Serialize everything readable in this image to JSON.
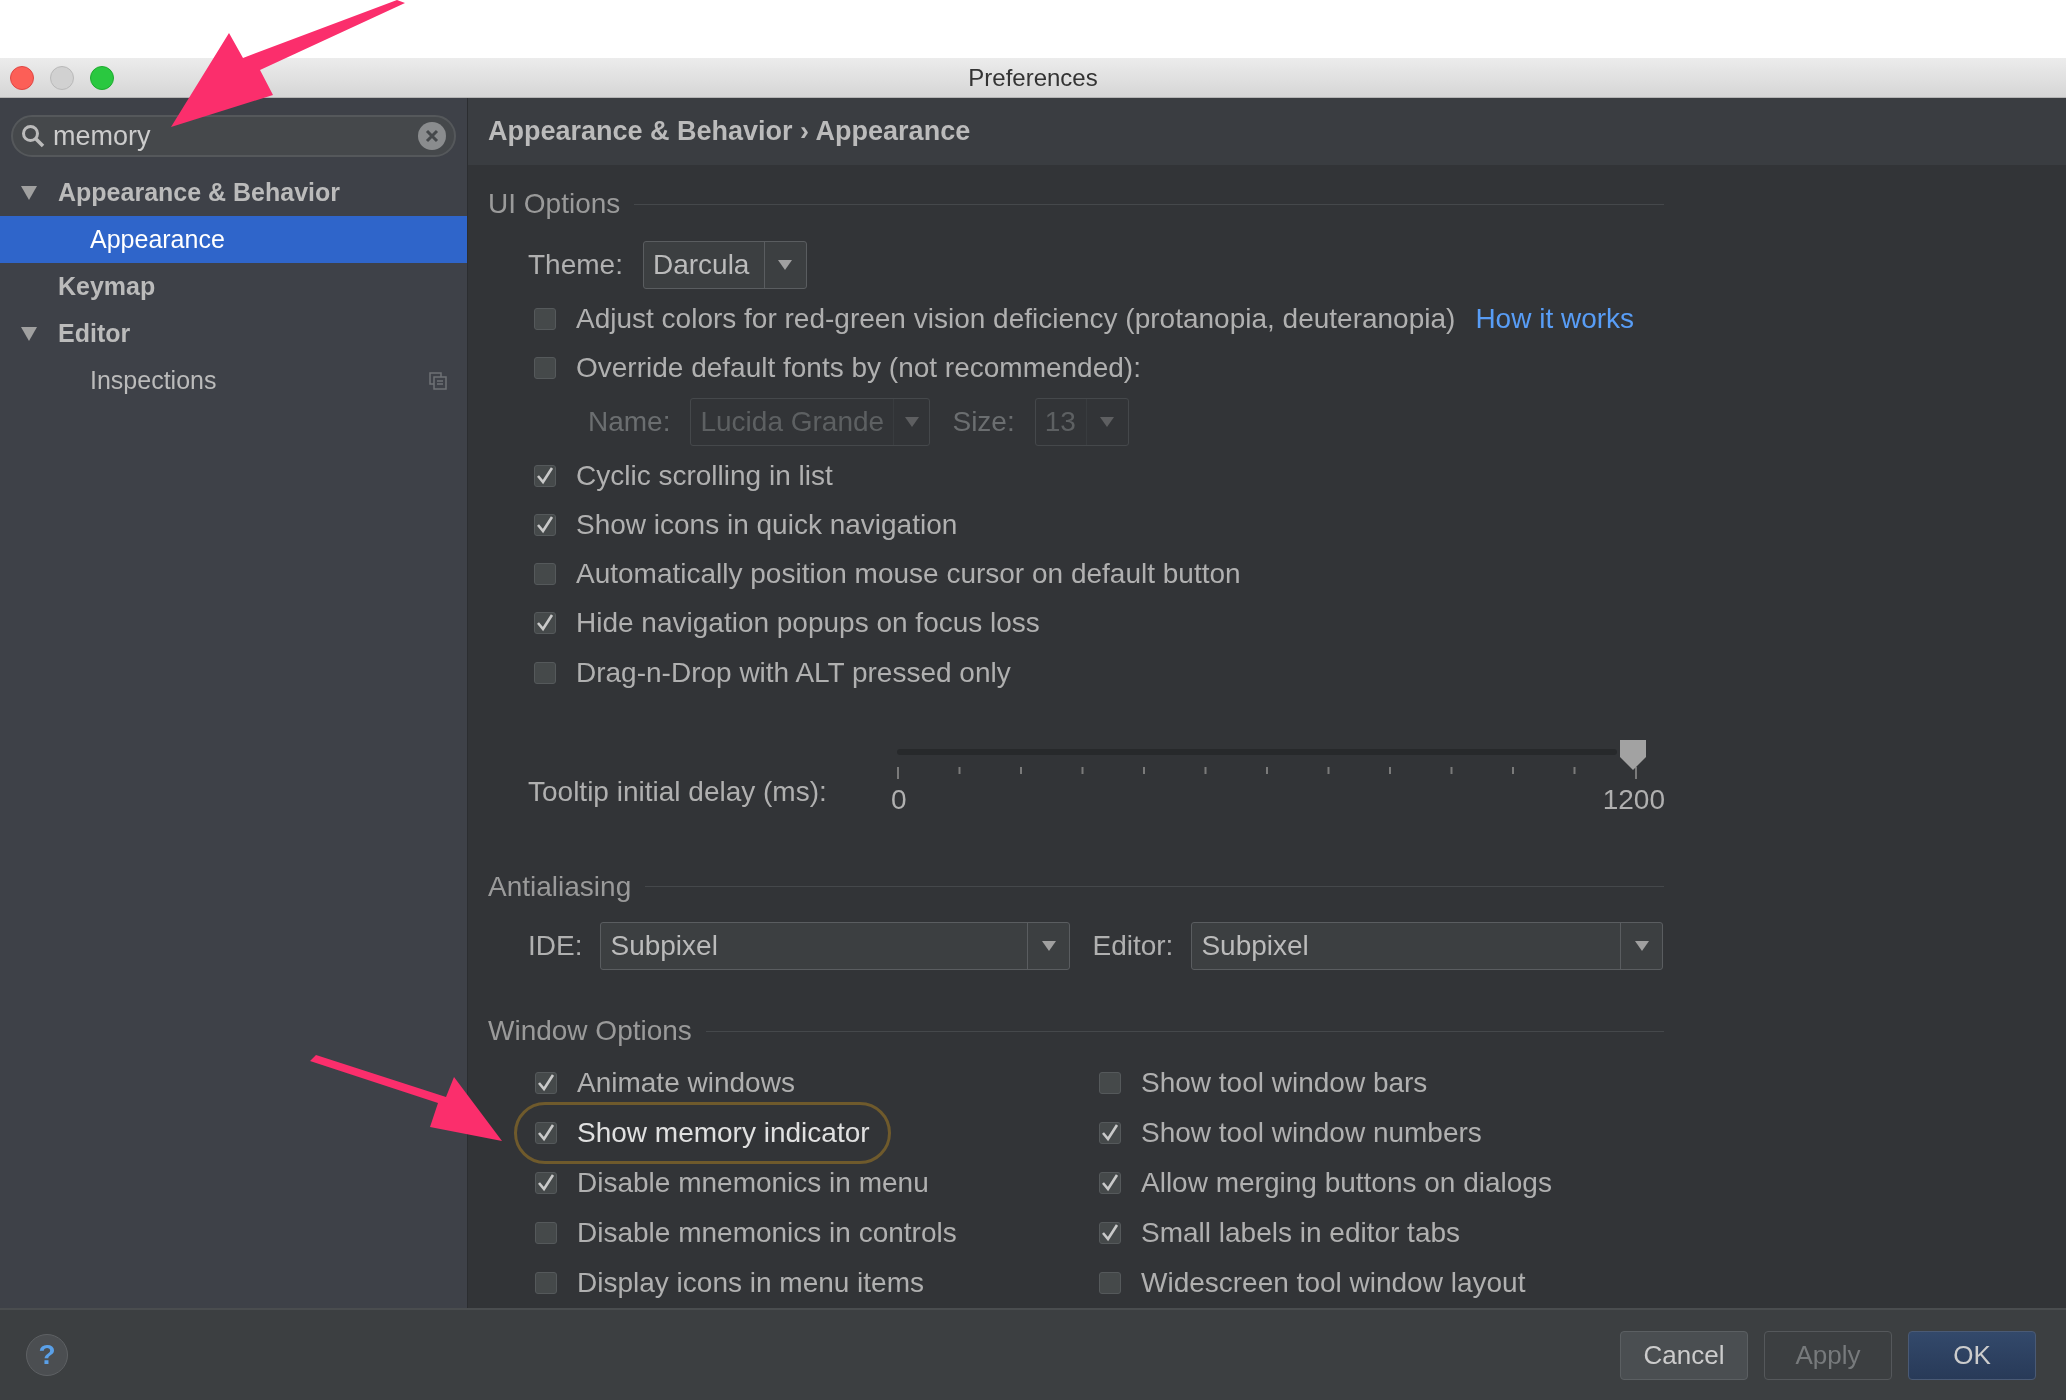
{
  "window": {
    "title": "Preferences"
  },
  "search": {
    "value": "memory"
  },
  "sidebar": {
    "items": [
      {
        "label": "Appearance & Behavior",
        "expanded": true,
        "selected": false,
        "children": [
          {
            "label": "Appearance",
            "selected": true,
            "copy_icon": false
          }
        ]
      },
      {
        "label": "Keymap",
        "selected": false
      },
      {
        "label": "Editor",
        "expanded": true,
        "selected": false,
        "children": [
          {
            "label": "Inspections",
            "selected": false,
            "copy_icon": true
          }
        ]
      }
    ]
  },
  "breadcrumb": "Appearance & Behavior › Appearance",
  "ui_options": {
    "title": "UI Options",
    "theme": {
      "label": "Theme:",
      "value": "Darcula"
    },
    "rows": [
      {
        "kind": "checkbox",
        "label": "Adjust colors for red-green vision deficiency (protanopia, deuteranopia)",
        "checked": false,
        "link": "How it works"
      },
      {
        "kind": "checkbox",
        "label": "Override default fonts by (not recommended):",
        "checked": false
      },
      {
        "kind": "font",
        "name_label": "Name:",
        "name_value": "Lucida Grande",
        "size_label": "Size:",
        "size_value": "13",
        "disabled": true
      },
      {
        "kind": "checkbox",
        "label": "Cyclic scrolling in list",
        "checked": true
      },
      {
        "kind": "checkbox",
        "label": "Show icons in quick navigation",
        "checked": true
      },
      {
        "kind": "checkbox",
        "label": "Automatically position mouse cursor on default button",
        "checked": false
      },
      {
        "kind": "checkbox",
        "label": "Hide navigation popups on focus loss",
        "checked": true
      },
      {
        "kind": "checkbox",
        "label": "Drag-n-Drop with ALT pressed only",
        "checked": false
      }
    ],
    "tooltip_delay": {
      "label": "Tooltip initial delay (ms):",
      "level": 1,
      "min_label": "0",
      "max_label": "1200"
    }
  },
  "antialiasing": {
    "title": "Antialiasing",
    "ide": {
      "label": "IDE:",
      "value": "Subpixel"
    },
    "editor": {
      "label": "Editor:",
      "value": "Subpixel"
    }
  },
  "window_options": {
    "title": "Window Options",
    "items": [
      {
        "label": "Animate windows",
        "checked": true,
        "highlighted": false
      },
      {
        "label": "Show tool window bars",
        "checked": false,
        "highlighted": false
      },
      {
        "label": "Show memory indicator",
        "checked": true,
        "highlighted": true
      },
      {
        "label": "Show tool window numbers",
        "checked": true,
        "highlighted": false
      },
      {
        "label": "Disable mnemonics in menu",
        "checked": true,
        "highlighted": false
      },
      {
        "label": "Allow merging buttons on dialogs",
        "checked": true,
        "highlighted": false
      },
      {
        "label": "Disable mnemonics in controls",
        "checked": false,
        "highlighted": false
      },
      {
        "label": "Small labels in editor tabs",
        "checked": true,
        "highlighted": false
      },
      {
        "label": "Display icons in menu items",
        "checked": false,
        "highlighted": false
      },
      {
        "label": "Widescreen tool window layout",
        "checked": false,
        "highlighted": false
      }
    ]
  },
  "help": "?",
  "buttons": [
    {
      "label": "Cancel",
      "disabled": false,
      "default": false
    },
    {
      "label": "Apply",
      "disabled": true,
      "default": false
    },
    {
      "label": "OK",
      "disabled": false,
      "default": true
    }
  ]
}
